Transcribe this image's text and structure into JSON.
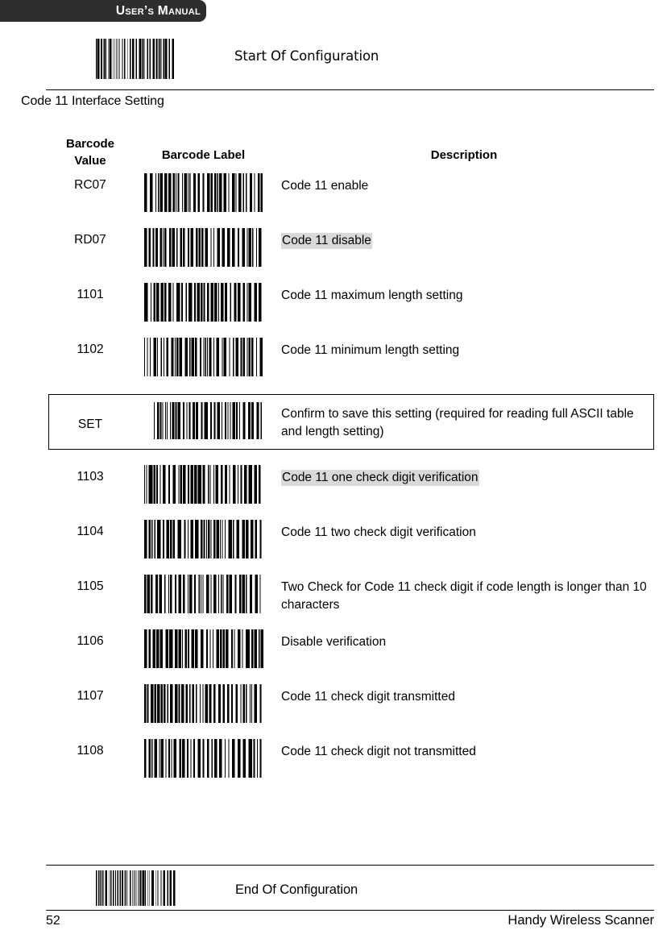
{
  "header": {
    "title": "User’s Manual"
  },
  "start_config": {
    "label": "Start Of Configuration",
    "barcode_icon": "barcode-icon"
  },
  "section": {
    "title": "Code 11 Interface Setting"
  },
  "table": {
    "columns": [
      "Barcode Value",
      "Barcode Label",
      "Description"
    ],
    "column_headers": {
      "value": "Barcode\nValue",
      "value_line1": "Barcode",
      "value_line2": "Value",
      "label": "Barcode Label",
      "description": "Description"
    },
    "rows": [
      {
        "value": "RC07",
        "barcode_icon": "barcode-icon",
        "description": "Code 11 enable",
        "highlighted": false,
        "boxed": false
      },
      {
        "value": "RD07",
        "barcode_icon": "barcode-icon",
        "description": "Code 11 disable",
        "highlighted": true,
        "boxed": false
      },
      {
        "value": "1101",
        "barcode_icon": "barcode-icon",
        "description": "Code 11 maximum length setting",
        "highlighted": false,
        "boxed": false
      },
      {
        "value": "1102",
        "barcode_icon": "barcode-icon",
        "description": "Code 11 minimum length setting",
        "highlighted": false,
        "boxed": false
      },
      {
        "value": "SET",
        "barcode_icon": "barcode-icon",
        "description": "Confirm to save this setting (required for reading full ASCII table and length setting)",
        "highlighted": false,
        "boxed": true
      },
      {
        "value": "1103",
        "barcode_icon": "barcode-icon",
        "description": "Code 11 one check digit verification",
        "highlighted": true,
        "boxed": false
      },
      {
        "value": "1104",
        "barcode_icon": "barcode-icon",
        "description": "Code 11 two check digit verification",
        "highlighted": false,
        "boxed": false
      },
      {
        "value": "1105",
        "barcode_icon": "barcode-icon",
        "description": "Two Check for Code 11 check digit if code length is longer than 10 characters",
        "highlighted": false,
        "boxed": false
      },
      {
        "value": "1106",
        "barcode_icon": "barcode-icon",
        "description": "Disable verification",
        "highlighted": false,
        "boxed": false
      },
      {
        "value": "1107",
        "barcode_icon": "barcode-icon",
        "description": "Code 11 check digit transmitted",
        "highlighted": false,
        "boxed": false
      },
      {
        "value": "1108",
        "barcode_icon": "barcode-icon",
        "description": "Code 11 check digit not transmitted",
        "highlighted": false,
        "boxed": false
      }
    ]
  },
  "end_config": {
    "label": "End Of Configuration",
    "barcode_icon": "barcode-icon"
  },
  "footer": {
    "page_number": "52",
    "brand": "Handy Wireless Scanner"
  },
  "colors": {
    "header_bar": "#2e2e2e",
    "header_text": "#ffffff",
    "highlight": "#d9d9d9",
    "rule": "#000000",
    "page_background": "#ffffff"
  },
  "layout": {
    "row_tops": [
      215,
      283,
      351,
      419,
      492,
      577,
      645,
      713,
      781,
      849,
      917
    ],
    "value_tops": [
      222,
      290,
      358,
      426,
      519,
      584,
      652,
      720,
      788,
      856,
      924
    ],
    "desc_tops": [
      220,
      288,
      356,
      424,
      503,
      582,
      650,
      718,
      786,
      854,
      922
    ]
  }
}
